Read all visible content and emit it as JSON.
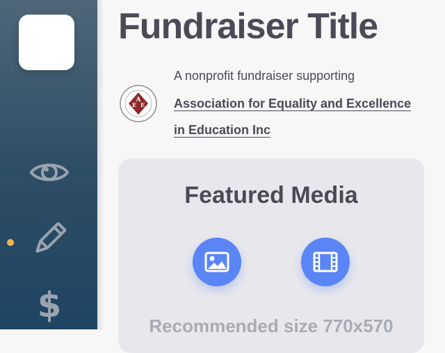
{
  "page": {
    "title": "Fundraiser Title",
    "supporting_text": "A nonprofit fundraiser supporting",
    "organization_name": "Association for Equality and Excellence in Education Inc",
    "organization_logo_letters": [
      "A",
      "E",
      "E"
    ]
  },
  "sidebar": {
    "items": [
      {
        "icon": "eye-icon"
      },
      {
        "icon": "pencil-icon",
        "active": true
      },
      {
        "icon": "dollar-icon",
        "glyph": "$"
      }
    ]
  },
  "featured_media": {
    "heading": "Featured Media",
    "buttons": [
      {
        "icon": "image-icon"
      },
      {
        "icon": "film-icon"
      }
    ],
    "recommended_size": "Recommended size 770x570"
  },
  "colors": {
    "accent": "#5b84f5",
    "active_dot": "#f2b451",
    "sidebar_top": "#4e6678",
    "sidebar_bottom": "#1f4462",
    "text": "#4a4b57"
  }
}
